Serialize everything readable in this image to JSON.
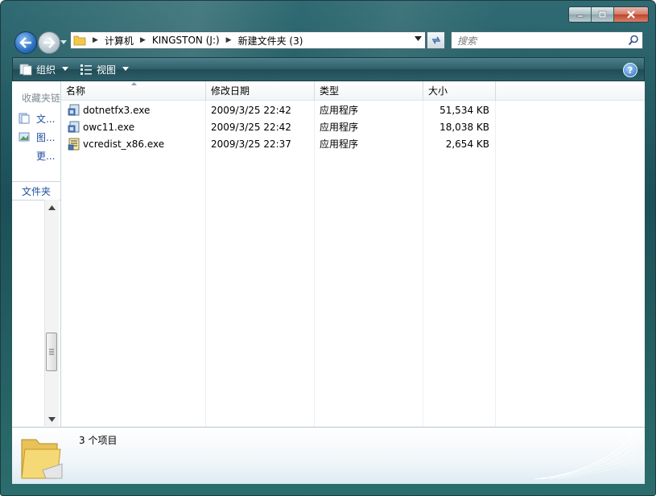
{
  "window": {
    "controls": {
      "minimize": "minimize",
      "maximize": "maximize",
      "close": "close"
    }
  },
  "address": {
    "breadcrumbs": [
      "计算机",
      "KINGSTON (J:)",
      "新建文件夹 (3)"
    ]
  },
  "search": {
    "placeholder": "搜索"
  },
  "toolbar": {
    "organize_label": "组织",
    "views_label": "视图"
  },
  "nav_pane": {
    "favorites_header": "收藏夹链",
    "items": [
      {
        "label": "文...",
        "icon": "documents-icon"
      },
      {
        "label": "图...",
        "icon": "pictures-icon"
      },
      {
        "label": "更..."
      }
    ],
    "folders_label": "文件夹"
  },
  "columns": [
    "名称",
    "修改日期",
    "类型",
    "大小"
  ],
  "files": [
    {
      "name": "dotnetfx3.exe",
      "modified": "2009/3/25 22:42",
      "type": "应用程序",
      "size": "51,534 KB",
      "icon": "installer-icon"
    },
    {
      "name": "owc11.exe",
      "modified": "2009/3/25 22:42",
      "type": "应用程序",
      "size": "18,038 KB",
      "icon": "installer-icon"
    },
    {
      "name": "vcredist_x86.exe",
      "modified": "2009/3/25 22:37",
      "type": "应用程序",
      "size": "2,654 KB",
      "icon": "setup-icon"
    }
  ],
  "details": {
    "item_count": "3 个项目"
  },
  "colors": {
    "frame": "#2b6069",
    "link": "#1f4f9e",
    "accent": "#2a6fc0"
  }
}
